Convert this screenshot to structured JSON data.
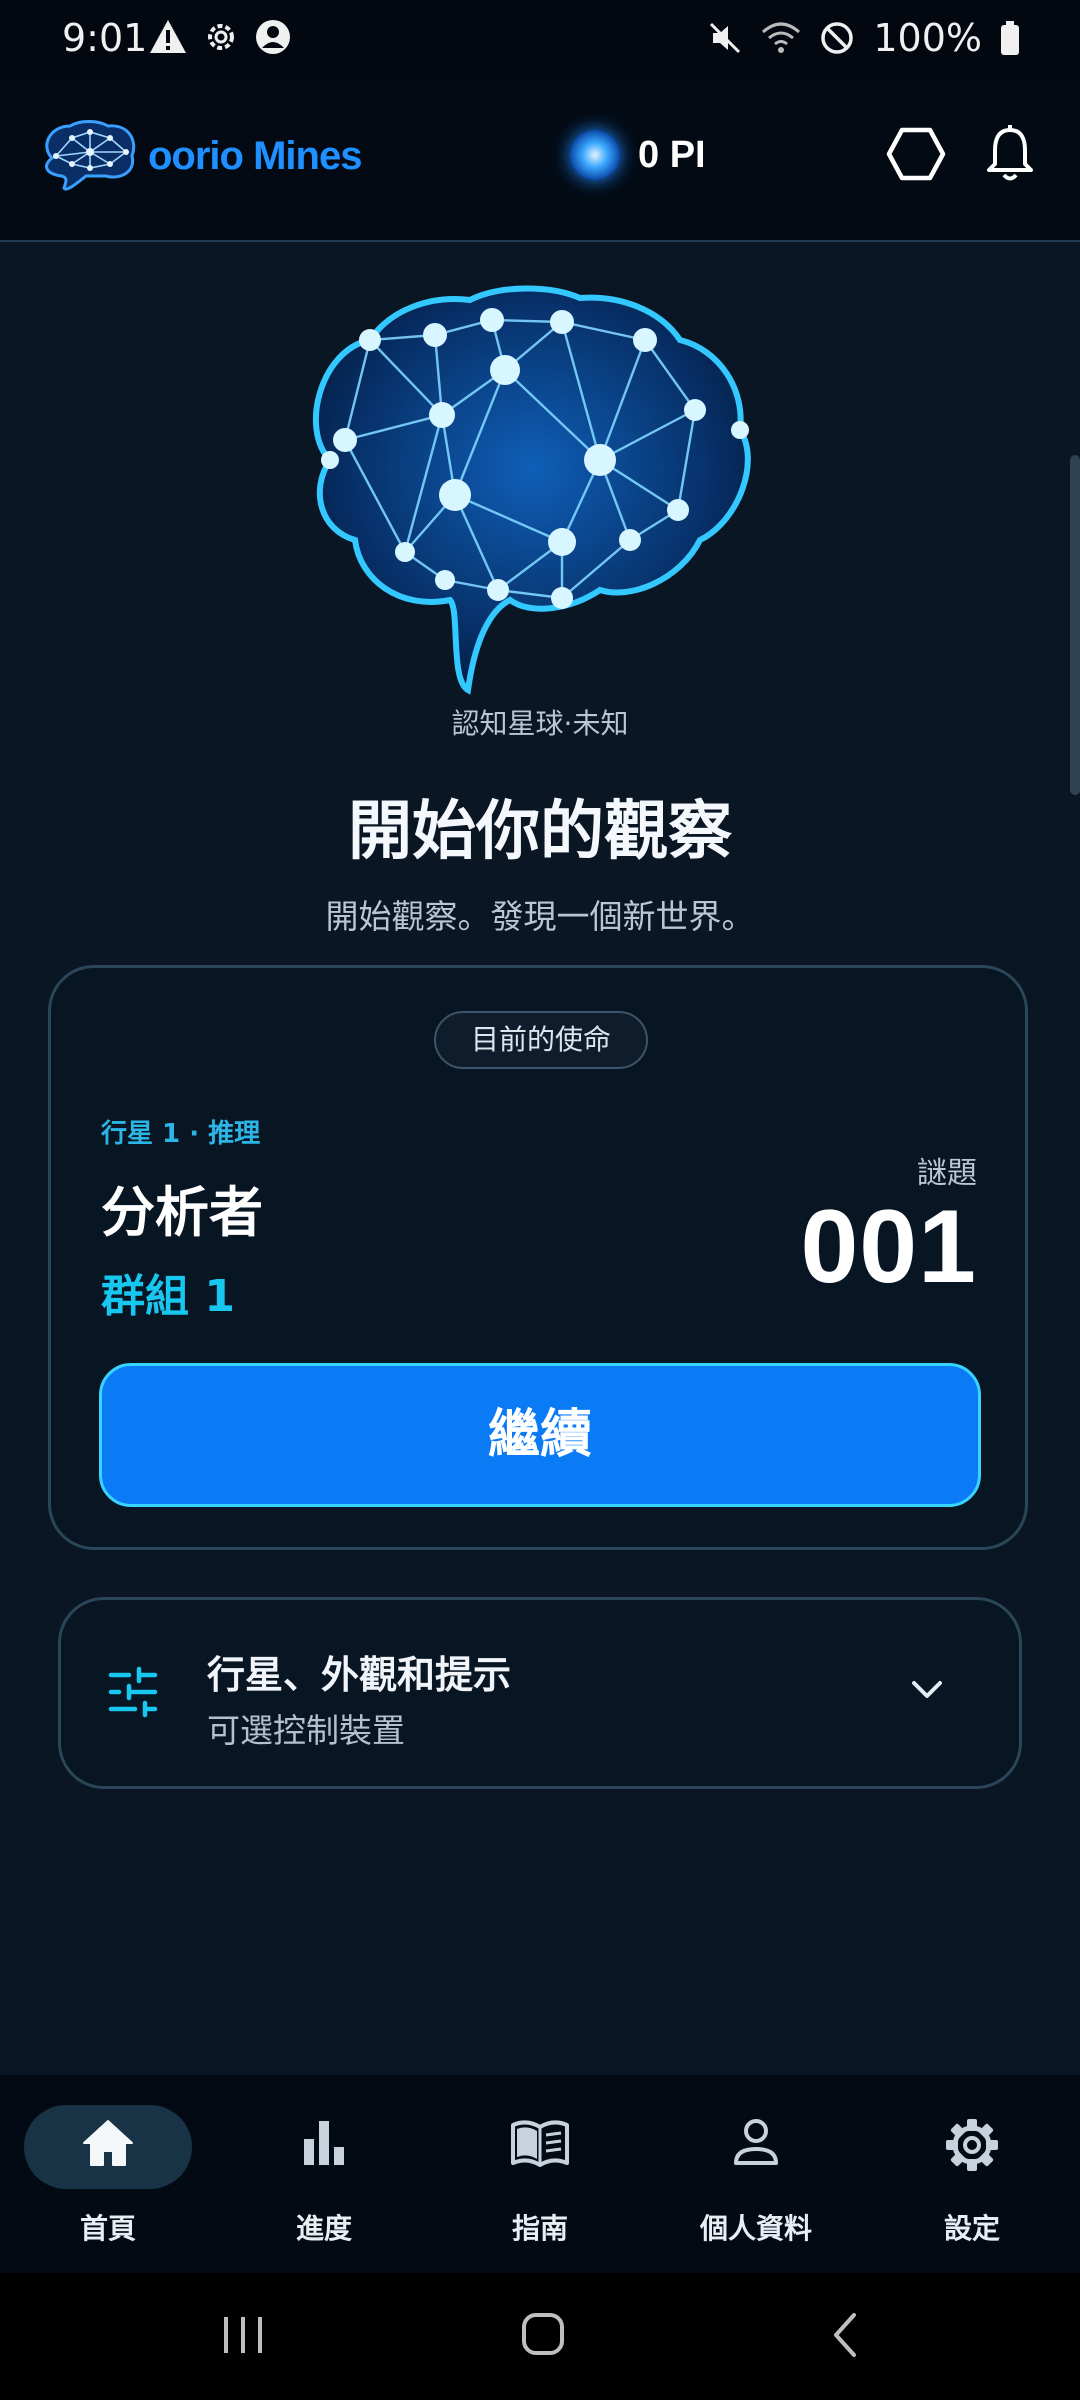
{
  "status_bar": {
    "time": "9:01",
    "battery": "100%",
    "left_icons": [
      "warning-icon",
      "settings-icon",
      "account-circle-icon"
    ],
    "right_icons": [
      "mute-icon",
      "wifi-icon",
      "do-not-disturb-icon",
      "battery-icon"
    ]
  },
  "header": {
    "logo_text": "oorio Mines",
    "balance": "0 PI"
  },
  "hero": {
    "planet_label": "認知星球·未知",
    "title": "開始你的觀察",
    "subtitle": "開始觀察。發現一個新世界。"
  },
  "mission": {
    "badge": "目前的使命",
    "path": "行星 1 · 推理",
    "role": "分析者",
    "group": "群組 1",
    "puzzle_label": "謎題",
    "puzzle_number": "001",
    "continue_label": "繼續"
  },
  "options": {
    "title": "行星、外觀和提示",
    "subtitle": "可選控制裝置"
  },
  "bottom_nav": {
    "items": [
      {
        "label": "首頁",
        "icon": "home-icon",
        "active": true
      },
      {
        "label": "進度",
        "icon": "bar-chart-icon",
        "active": false
      },
      {
        "label": "指南",
        "icon": "book-icon",
        "active": false
      },
      {
        "label": "個人資料",
        "icon": "person-icon",
        "active": false
      },
      {
        "label": "設定",
        "icon": "gear-icon",
        "active": false
      }
    ]
  },
  "colors": {
    "background": "#0a1624",
    "accent": "#18c7f0",
    "button": "#0a7bf5",
    "nav_active_pill": "#183345"
  }
}
